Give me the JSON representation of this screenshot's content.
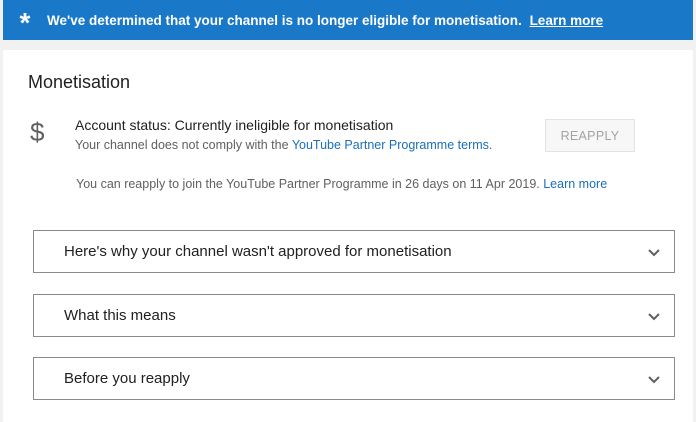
{
  "banner": {
    "icon": "asterisk-icon",
    "message": "We've determined that your channel is no longer eligible for monetisation.",
    "link": "Learn more",
    "bg_color": "#1a78c9"
  },
  "monetisation": {
    "title": "Monetisation",
    "icon": "dollar-icon",
    "status": "Account status: Currently ineligible for monetisation",
    "sub_prefix": "Your channel does not comply with the ",
    "sub_link": "YouTube Partner Programme terms",
    "sub_suffix": ".",
    "reapply_button": "REAPPLY",
    "reapply_note": "You can reapply to join the YouTube Partner Programme in 26 days on 11 Apr 2019.",
    "reapply_note_link": "Learn more",
    "link_color": "#1a6fb8"
  },
  "accordions": [
    {
      "label": "Here's why your channel wasn't approved for monetisation",
      "icon": "chevron-down-icon"
    },
    {
      "label": "What this means",
      "icon": "chevron-down-icon"
    },
    {
      "label": "Before you reapply",
      "icon": "chevron-down-icon"
    }
  ]
}
